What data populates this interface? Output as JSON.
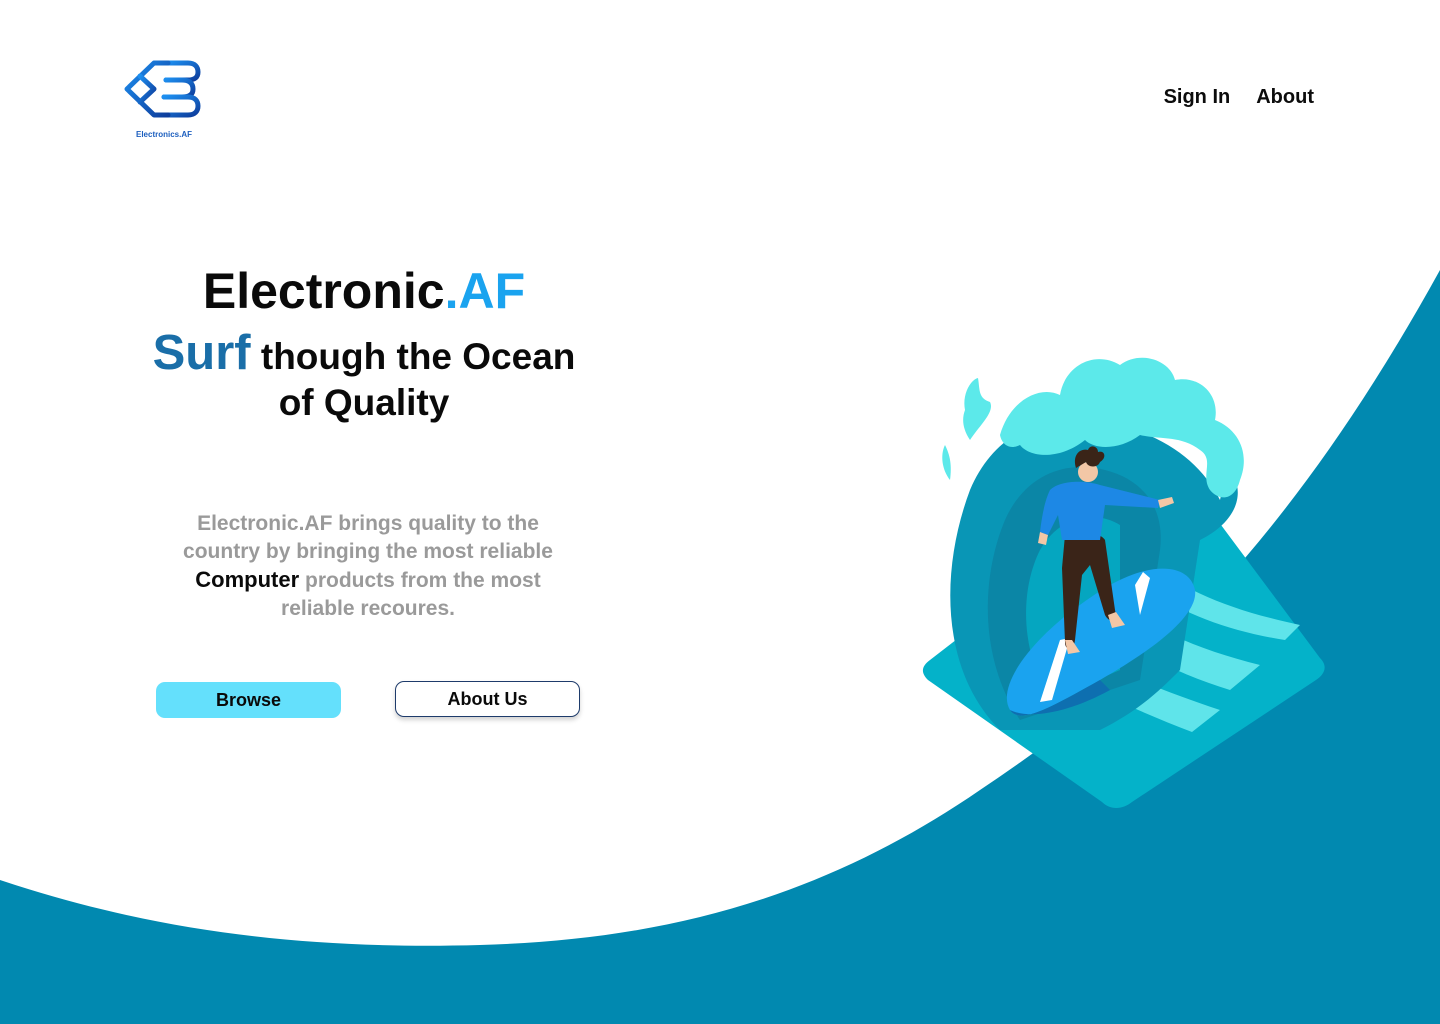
{
  "brand": {
    "logo_text": "Electronics.AF"
  },
  "nav": {
    "sign_in": "Sign In",
    "about": "About"
  },
  "hero": {
    "title_main": "Electronic",
    "title_accent": ".AF",
    "tagline_highlight": "Surf",
    "tagline_line1_rest": " though the Ocean",
    "tagline_line2": "of Quality",
    "description_part1": "Electronic.AF brings quality to the country by bringing the most reliable ",
    "description_strong": "Computer",
    "description_part2": " products from the most reliable recoures."
  },
  "buttons": {
    "browse": "Browse",
    "about_us": "About Us"
  },
  "colors": {
    "ocean": "#0189b0",
    "accent": "#1aa3ef",
    "surf_text": "#1a6ea8",
    "browse_button": "#64e0fc",
    "about_border": "#1e3b6b",
    "description_text": "#9a9a9a"
  },
  "icons": {
    "logo": "electronics-af-logo",
    "illustration": "surfer-wave-illustration"
  }
}
